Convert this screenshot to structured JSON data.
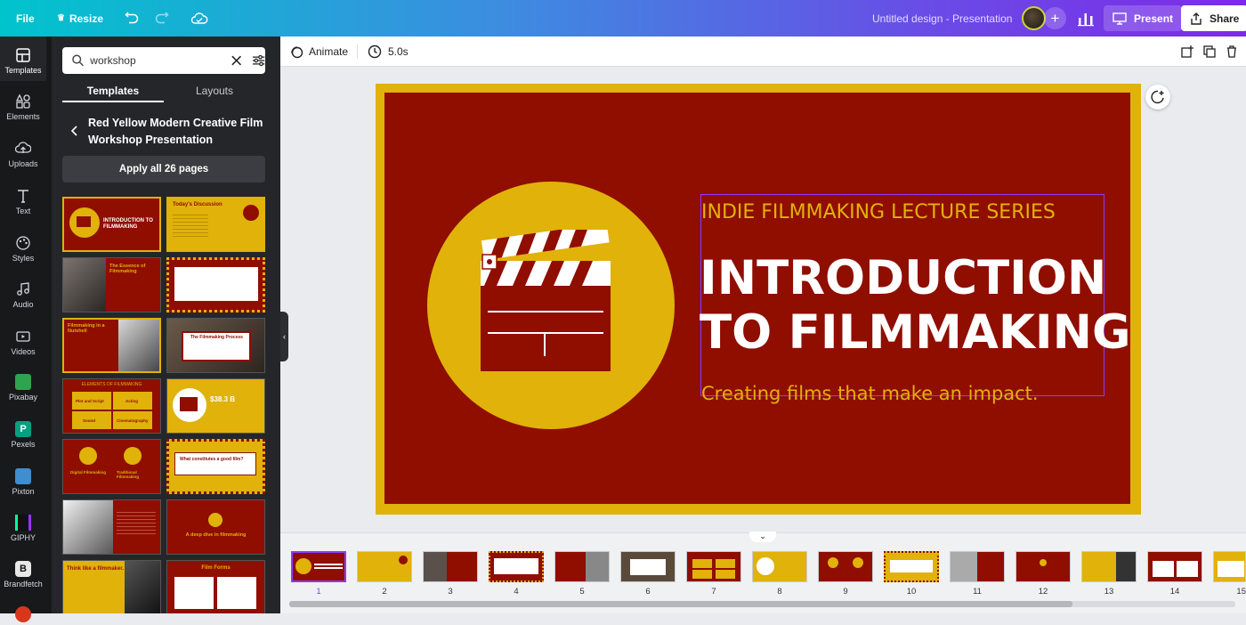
{
  "topbar": {
    "file_label": "File",
    "resize_label": "Resize",
    "design_title": "Untitled design - Presentation",
    "present_label": "Present",
    "share_label": "Share"
  },
  "rail": {
    "items": [
      {
        "label": "Templates",
        "icon": "templates-icon"
      },
      {
        "label": "Elements",
        "icon": "elements-icon"
      },
      {
        "label": "Uploads",
        "icon": "uploads-icon"
      },
      {
        "label": "Text",
        "icon": "text-icon"
      },
      {
        "label": "Styles",
        "icon": "styles-icon"
      },
      {
        "label": "Audio",
        "icon": "audio-icon"
      },
      {
        "label": "Videos",
        "icon": "videos-icon"
      },
      {
        "label": "Pixabay",
        "icon": "pixabay-icon"
      },
      {
        "label": "Pexels",
        "icon": "pexels-icon"
      },
      {
        "label": "Pixton",
        "icon": "pixton-icon"
      },
      {
        "label": "GIPHY",
        "icon": "giphy-icon"
      },
      {
        "label": "Brandfetch",
        "icon": "brandfetch-icon"
      }
    ]
  },
  "panel": {
    "search_value": "workshop",
    "tab_templates": "Templates",
    "tab_layouts": "Layouts",
    "template_title": "Red Yellow Modern Creative Film Workshop Presentation",
    "apply_label": "Apply all 26 pages"
  },
  "toolbar": {
    "animate_label": "Animate",
    "duration_label": "5.0s"
  },
  "slide": {
    "series": "INDIE FILMMAKING LECTURE SERIES",
    "headline_1": "INTRODUCTION",
    "headline_2": "TO FILMMAKING",
    "tagline": "Creating films that make an impact."
  },
  "thumbs": {
    "t1": "INTRODUCTION TO FILMMAKING",
    "t2": "Today's Discussion",
    "t3": "The Essence of Filmmaking",
    "t5": "Filmmaking in a Nutshell",
    "t6": "The Filmmaking Process",
    "t7": "ELEMENTS OF FILMMAKING",
    "t7b": "Plot and Script",
    "t7c": "Acting",
    "t7d": "Sound",
    "t7e": "Cinematography",
    "t8": "$38.3 B",
    "t9": "Digital Filmmaking",
    "t9b": "Traditional Filmmaking",
    "t10": "What constitutes a good film?",
    "t12": "A deep dive in filmmaking",
    "t13": "Think like a filmmaker.",
    "t14": "Film Forms"
  },
  "pages": [
    "1",
    "2",
    "3",
    "4",
    "5",
    "6",
    "7",
    "8",
    "9",
    "10",
    "11",
    "12",
    "13",
    "14",
    "15"
  ],
  "colors": {
    "maroon": "#8f0e00",
    "gold": "#e0b20a",
    "accent": "#8b3dff"
  }
}
